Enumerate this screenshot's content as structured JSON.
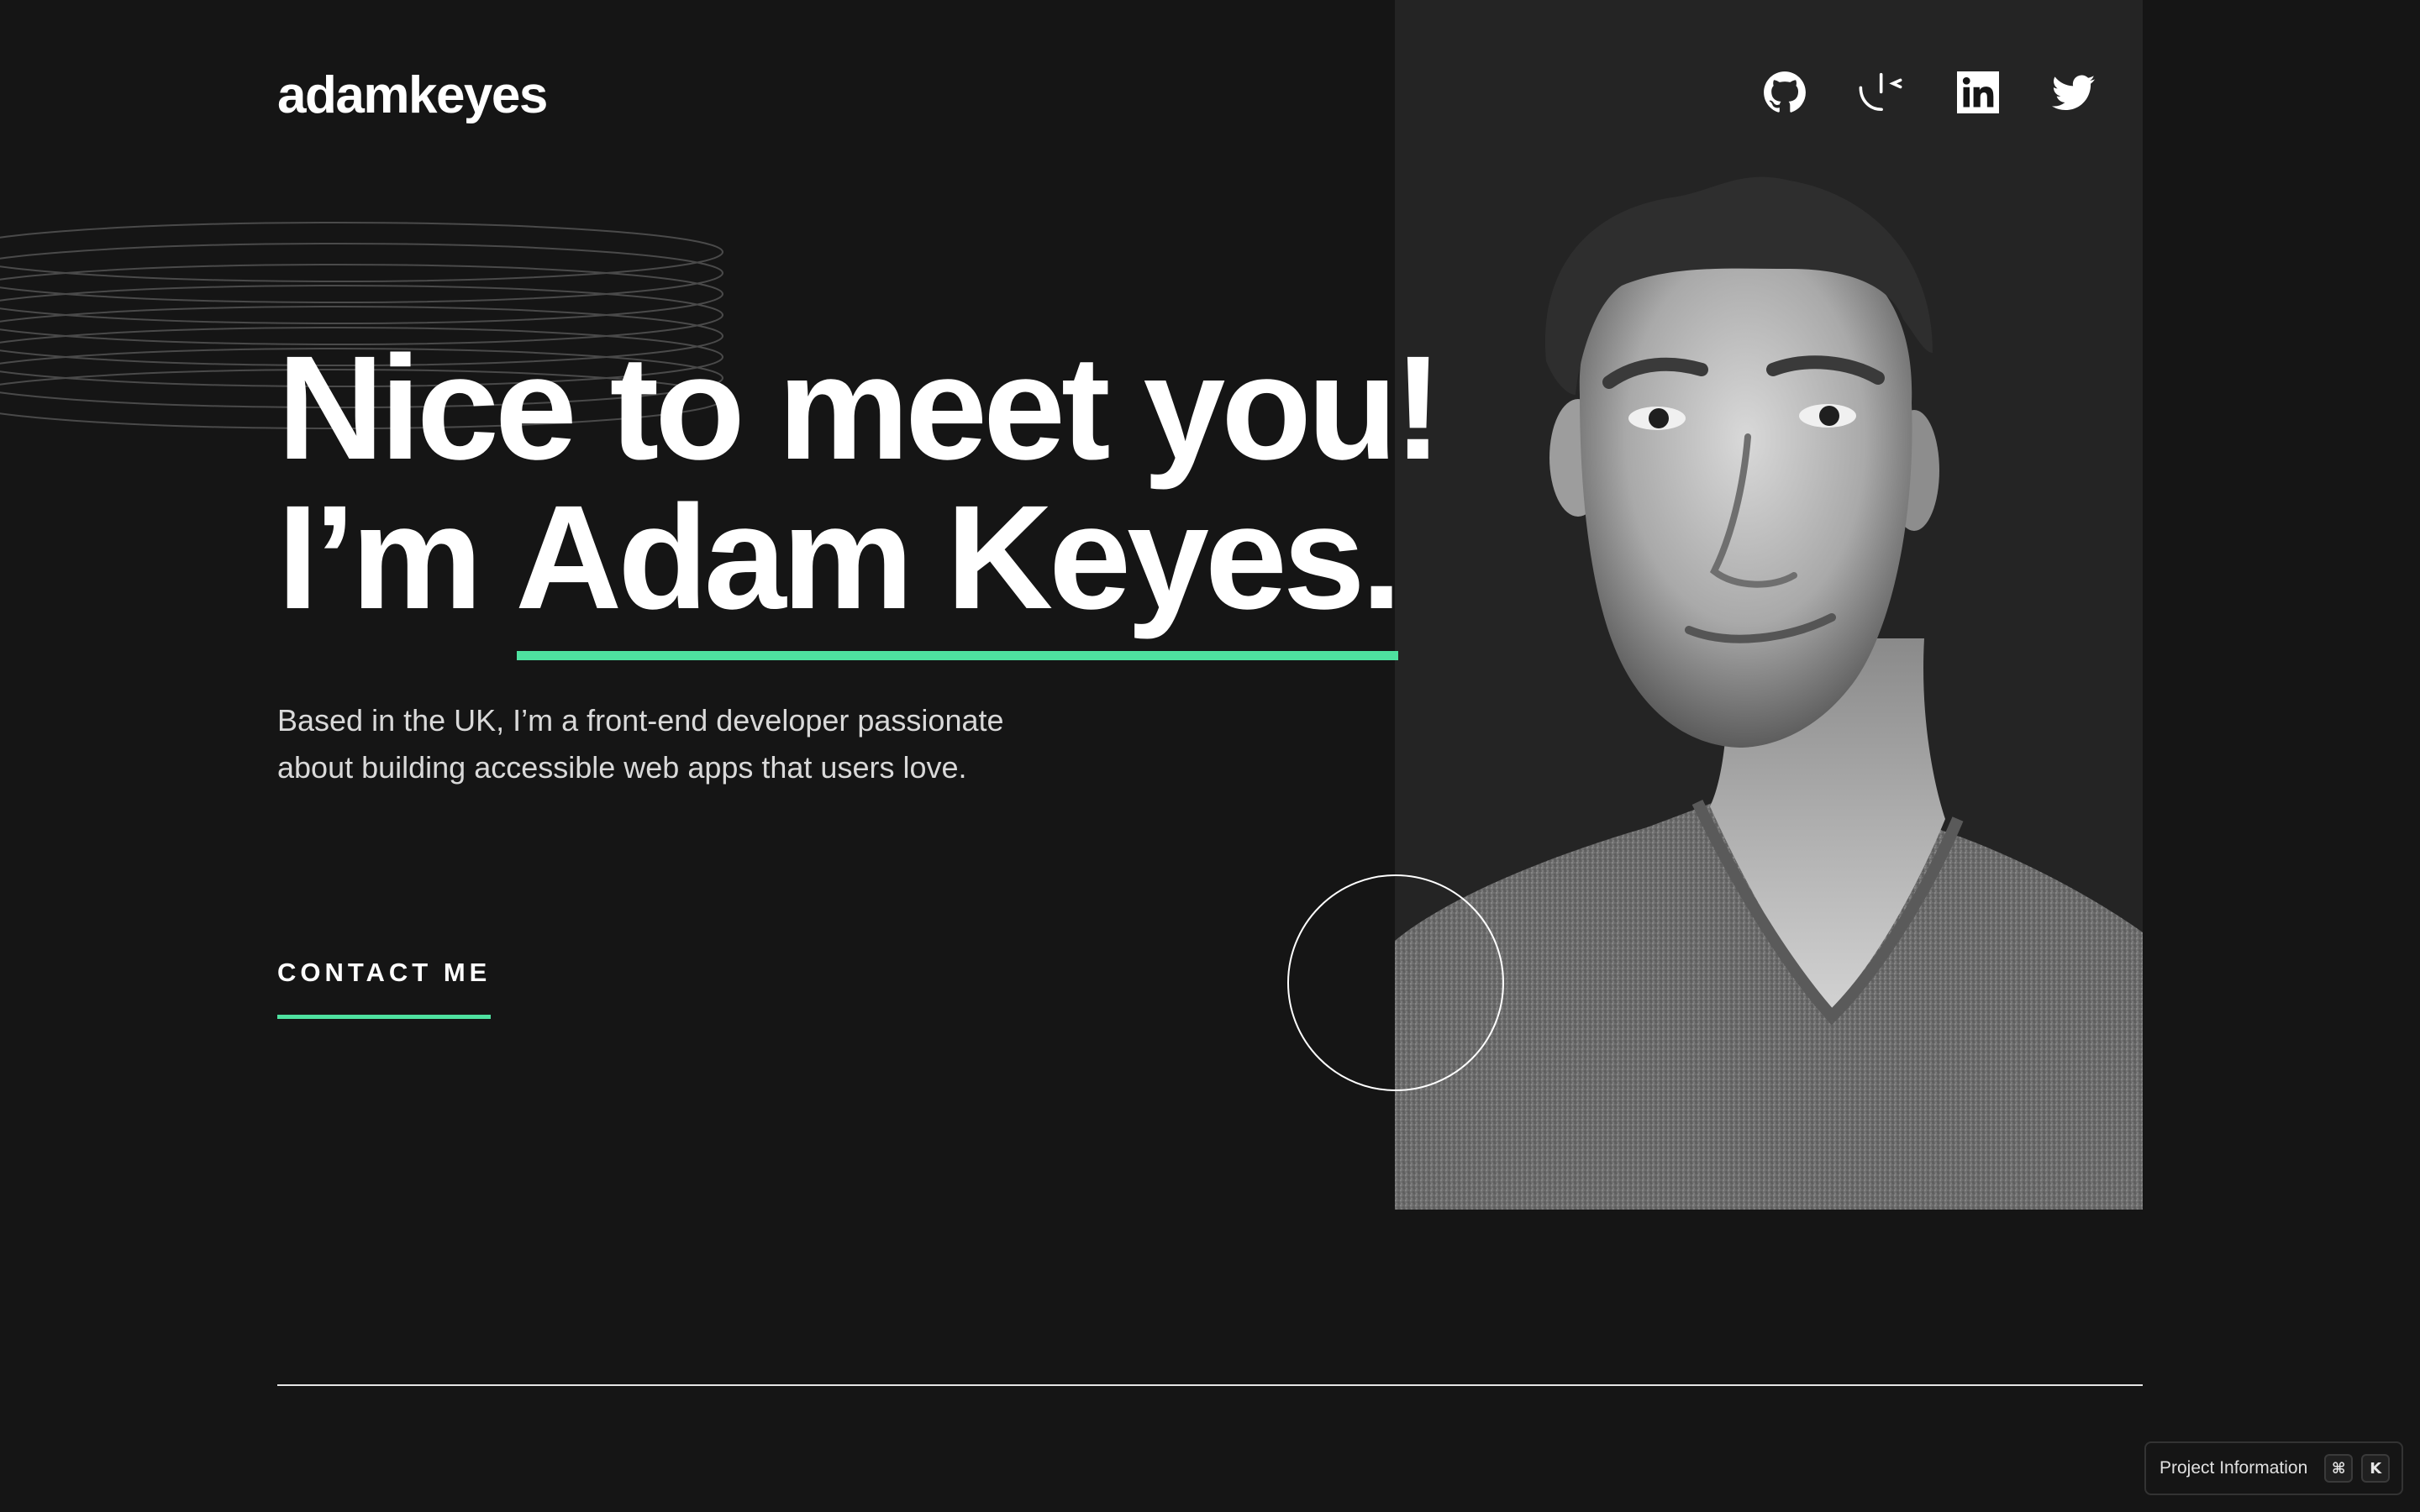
{
  "header": {
    "logo": "adamkeyes",
    "social": [
      {
        "name": "github",
        "icon": "github-icon"
      },
      {
        "name": "frontend-mentor",
        "icon": "frontend-mentor-icon"
      },
      {
        "name": "linkedin",
        "icon": "linkedin-icon"
      },
      {
        "name": "twitter",
        "icon": "twitter-icon"
      }
    ]
  },
  "hero": {
    "line1": "Nice to meet you!",
    "line2_prefix": "I’m ",
    "name": "Adam Keyes.",
    "intro": "Based in the UK, I’m a front-end developer passionate about building accessible web apps that users love.",
    "contact_label": "CONTACT ME",
    "portrait_icon": "portrait-photo"
  },
  "project_info": {
    "label": "Project Information",
    "key1": "⌘",
    "key2": "K"
  },
  "colors": {
    "background": "#151515",
    "panel": "#242424",
    "accent": "#4ee1a0",
    "text": "#ffffff",
    "body_text": "#d9d9d9"
  }
}
